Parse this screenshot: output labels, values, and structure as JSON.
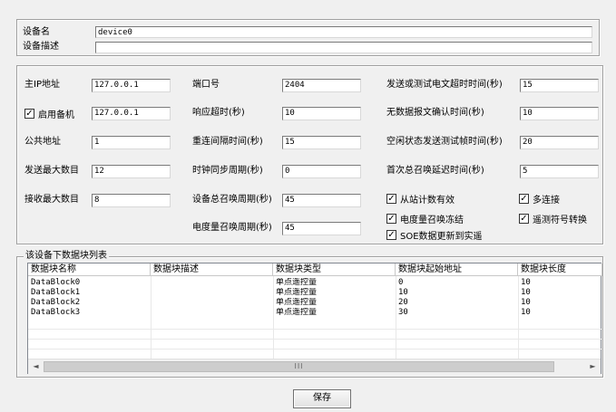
{
  "device": {
    "name_label": "设备名",
    "name_value": "device0",
    "desc_label": "设备描述",
    "desc_value": ""
  },
  "params": {
    "main_ip_label": "主IP地址",
    "main_ip_value": "127.0.0.1",
    "backup_label": "启用备机",
    "backup_checked": "✓",
    "backup_ip_value": "127.0.0.1",
    "common_addr_label": "公共地址",
    "common_addr_value": "1",
    "send_max_label": "发送最大数目",
    "send_max_value": "12",
    "recv_max_label": "接收最大数目",
    "recv_max_value": "8",
    "port_label": "端口号",
    "port_value": "2404",
    "resp_timeout_label": "响应超时(秒)",
    "resp_timeout_value": "10",
    "reconnect_label": "重连间隔时间(秒)",
    "reconnect_value": "15",
    "clock_sync_label": "时钟同步周期(秒)",
    "clock_sync_value": "0",
    "total_call_label": "设备总召唤周期(秒)",
    "total_call_value": "45",
    "energy_call_label": "电度量召唤周期(秒)",
    "energy_call_value": "45",
    "send_test_label": "发送或测试电文超时时间(秒)",
    "send_test_value": "15",
    "no_data_ack_label": "无数据报文确认时间(秒)",
    "no_data_ack_value": "10",
    "idle_test_label": "空闲状态发送测试帧时间(秒)",
    "idle_test_value": "20",
    "first_call_delay_label": "首次总召唤延迟时间(秒)",
    "first_call_delay_value": "5"
  },
  "options": {
    "slave_count_label": "从站计数有效",
    "multi_conn_label": "多连接",
    "energy_freeze_label": "电度量召唤冻结",
    "telemetry_sign_label": "遥测符号转换",
    "soe_update_label": "SOE数据更新到实遥",
    "check_mark": "✓"
  },
  "blocks": {
    "group_title": "该设备下数据块列表",
    "columns": [
      "数据块名称",
      "数据块描述",
      "数据块类型",
      "数据块起始地址",
      "数据块长度"
    ],
    "rows": [
      [
        "DataBlock0",
        "",
        "单点遥控量",
        "0",
        "10"
      ],
      [
        "DataBlock1",
        "",
        "单点遥控量",
        "10",
        "10"
      ],
      [
        "DataBlock2",
        "",
        "单点遥控量",
        "20",
        "10"
      ],
      [
        "DataBlock3",
        "",
        "单点遥控量",
        "30",
        "10"
      ]
    ],
    "scroll_thumb": "III",
    "scroll_left": "◄",
    "scroll_right": "►"
  },
  "actions": {
    "save_label": "保存"
  }
}
